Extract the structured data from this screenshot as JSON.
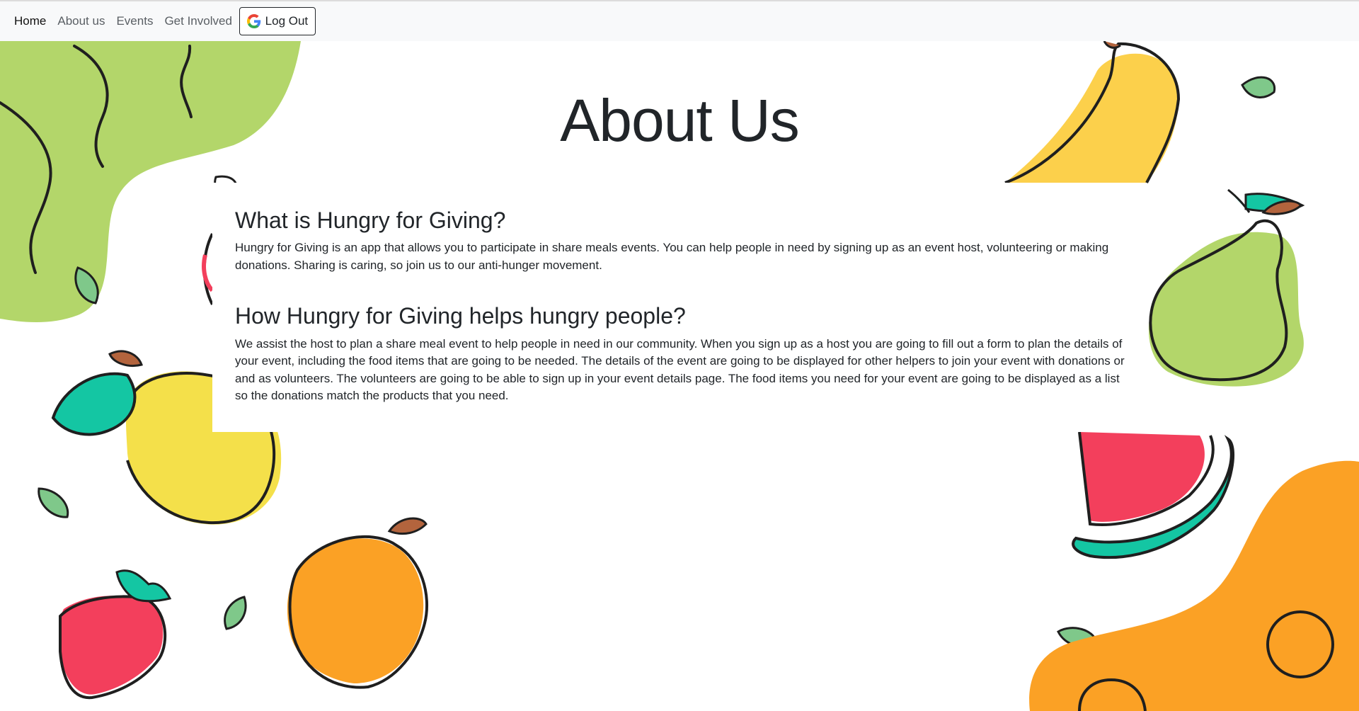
{
  "nav": {
    "items": [
      {
        "label": "Home",
        "active": true
      },
      {
        "label": "About us",
        "active": false
      },
      {
        "label": "Events",
        "active": false
      },
      {
        "label": "Get Involved",
        "active": false
      }
    ],
    "logout_label": "Log Out",
    "logout_icon": "google-g-icon"
  },
  "page": {
    "title": "About Us"
  },
  "sections": [
    {
      "heading": "What is Hungry for Giving?",
      "body": "Hungry for Giving is an app that allows you to participate in share meals events. You can help people in need by signing up as an event host, volunteering or making donations. Sharing is caring, so join us to our anti-hunger movement."
    },
    {
      "heading": "How Hungry for Giving helps hungry people?",
      "body": "We assist the host to plan a share meal event to help people in need in our community. When you sign up as a host you are going to fill out a form to plan the details of your event, including the food items that are going to be needed. The details of the event are going to be displayed for other helpers to join your event with donations or and as volunteers. The volunteers are going to be able to sign up in your event details page. The food items you need for your event are going to be displayed as a list so the donations match the products that you need."
    }
  ],
  "colors": {
    "green_blob": "#b3d66a",
    "banana": "#fcd04b",
    "pear": "#b3d66a",
    "lemon": "#f4e04a",
    "mango": "#fba125",
    "orange_blob": "#fba125",
    "strawberry": "#f33f5c",
    "watermelon": "#f33f5c",
    "teal_leaf": "#14c6a3",
    "stem": "#b3643d",
    "outline": "#1f1f1f"
  }
}
